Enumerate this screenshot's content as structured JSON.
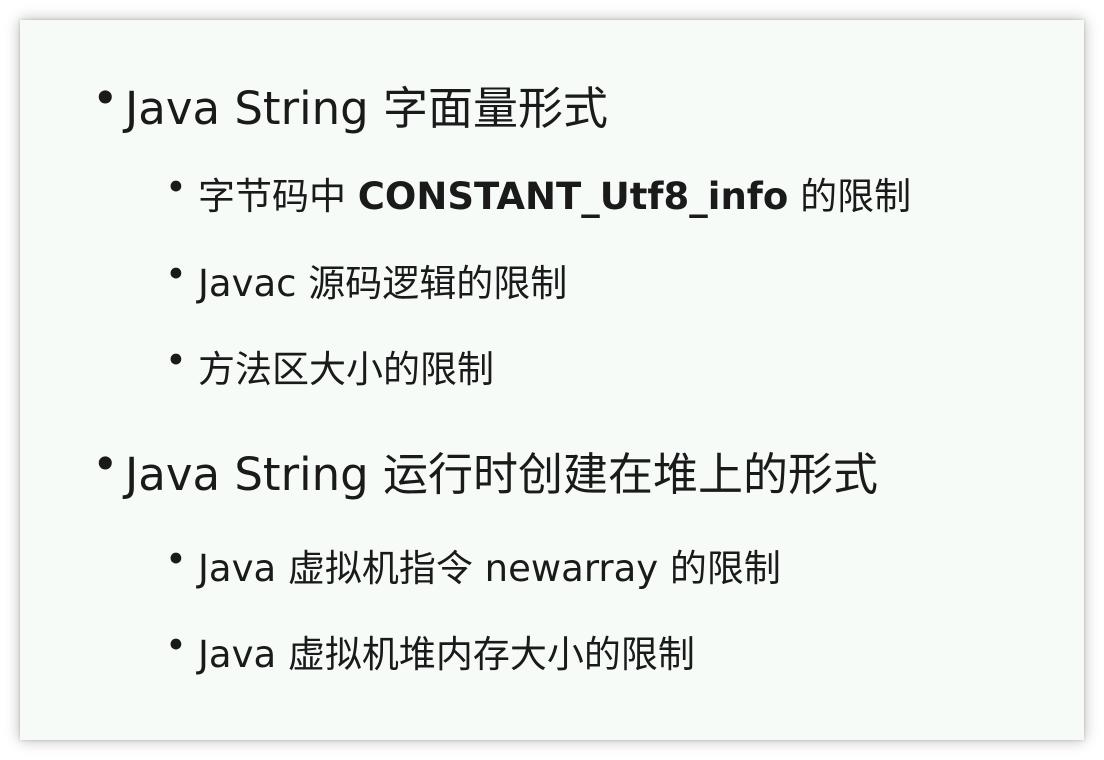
{
  "bullet_glyph": "•",
  "outline": [
    {
      "text": "Java String 字面量形式",
      "children": [
        {
          "before": "字节码中 ",
          "strong": "CONSTANT_Utf8_info",
          "after": " 的限制"
        },
        {
          "text": "Javac 源码逻辑的限制"
        },
        {
          "text": "方法区大小的限制"
        }
      ]
    },
    {
      "text": "Java String 运行时创建在堆上的形式",
      "children": [
        {
          "text": "Java 虚拟机指令 newarray 的限制"
        },
        {
          "text": "Java 虚拟机堆内存大小的限制"
        }
      ]
    }
  ]
}
